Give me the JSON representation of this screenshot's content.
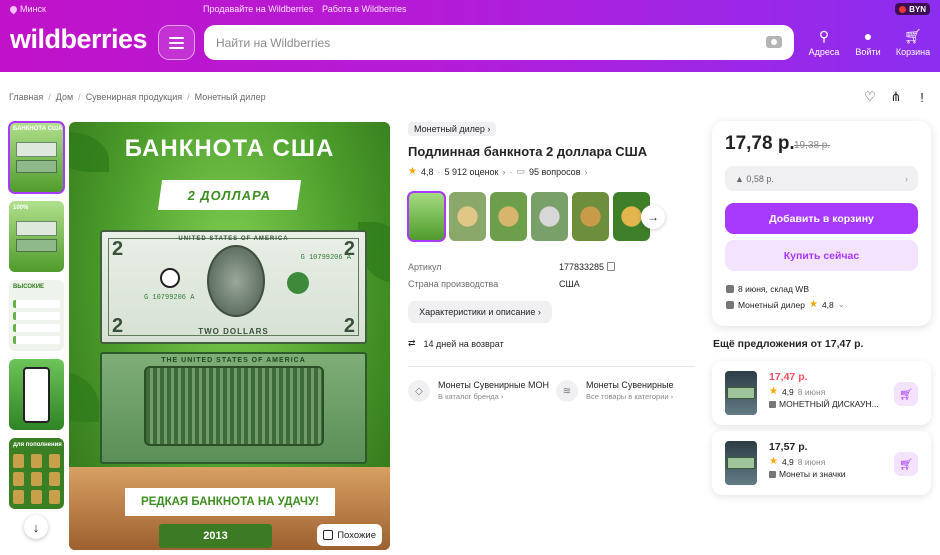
{
  "topbar": {
    "city": "Минск",
    "link1": "Продавайте на Wildberries",
    "link2": "Работа в Wildberries",
    "currency": "BYN"
  },
  "header": {
    "logo": "wildberries",
    "search_placeholder": "Найти на Wildberries",
    "nav": [
      {
        "label": "Адреса",
        "icon": "map-pin-icon"
      },
      {
        "label": "Войти",
        "icon": "user-icon"
      },
      {
        "label": "Корзина",
        "icon": "cart-icon"
      }
    ]
  },
  "breadcrumbs": [
    "Главная",
    "Дом",
    "Сувенирная продукция",
    "Монетный дилер"
  ],
  "gallery": {
    "title": "БАНКНОТА США",
    "tag": "2 ДОЛЛАРА",
    "ribbon": "РЕДКАЯ БАНКНОТА НА УДАЧУ!",
    "year": "2013",
    "similar": "Похожие",
    "bill_top_text": "UNITED STATES OF AMERICA",
    "bill_bottom_text": "TWO DOLLARS",
    "bill_back_text": "THE UNITED STATES OF AMERICA",
    "serial": "G 10799206 A",
    "thumb_captions": [
      "БАНКНОТА США",
      "100%",
      "ВЫСОКИЕ",
      "",
      "для пополнения"
    ]
  },
  "product": {
    "brand": "Монетный дилер",
    "title": "Подлинная банкнота 2 доллара США",
    "rating": "4,8",
    "reviews": "5 912 оценок",
    "questions": "95 вопросов",
    "article_label": "Артикул",
    "article": "177833285",
    "country_label": "Страна производства",
    "country": "США",
    "details_button": "Характеристики и описание",
    "return": "14 дней на возврат",
    "brand_links": [
      {
        "title": "Монеты Сувенирные МОН",
        "sub": "В каталог бренда"
      },
      {
        "title": "Монеты Сувенирные",
        "sub": "Все товары в категории"
      }
    ]
  },
  "buybox": {
    "price": "17,78 р.",
    "old_price": "19,38 р.",
    "wallet": "▲ 0,58 р.",
    "add_to_cart": "Добавить в корзину",
    "buy_now": "Купить сейчас",
    "delivery": "8 июня, склад WB",
    "seller": "Монетный дилер",
    "seller_rating": "4,8"
  },
  "offers": {
    "heading": "Ещё предложения от 17,47 р.",
    "items": [
      {
        "price": "17,47 р.",
        "price_color": "#f5515f",
        "rating": "4,9",
        "date": "8 июня",
        "seller": "МОНЕТНЫЙ ДИСКАУН..."
      },
      {
        "price": "17,57 р.",
        "price_color": "#242424",
        "rating": "4,9",
        "date": "8 июня",
        "seller": "Монеты и значки"
      }
    ]
  },
  "colors": {
    "accent": "#a73afd",
    "header_start": "#c012c9",
    "header_end": "#8b2ef0",
    "star": "#ffa500"
  }
}
